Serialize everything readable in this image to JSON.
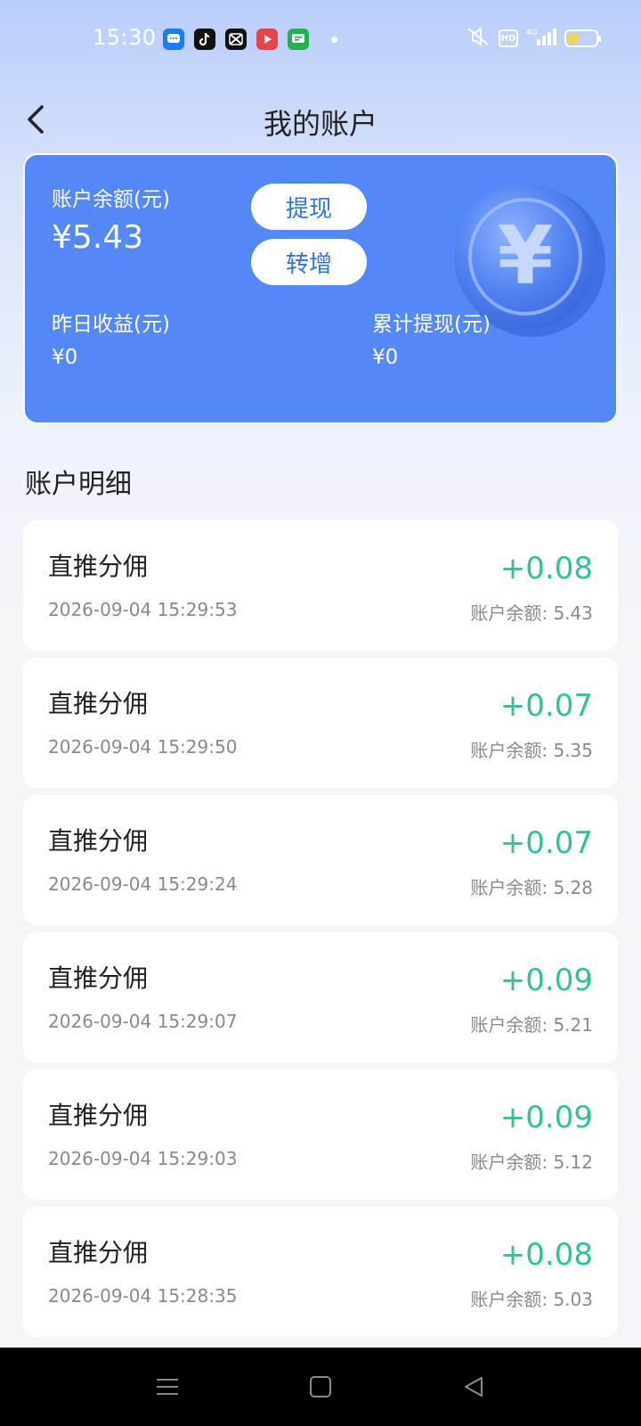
{
  "status_bar": {
    "time": "15:30",
    "network": "4G",
    "hd": "HD",
    "battery_level": 0.35,
    "notifications": [
      "message-icon",
      "tiktok-icon",
      "capcut-icon",
      "video-icon",
      "chat-icon"
    ]
  },
  "header": {
    "title": "我的账户"
  },
  "balance_card": {
    "balance_label": "账户余额(元)",
    "balance_value": "¥5.43",
    "withdraw_label": "提现",
    "transfer_label": "转增",
    "yesterday_label": "昨日收益(元)",
    "yesterday_value": "¥0",
    "total_withdraw_label": "累计提现(元)",
    "total_withdraw_value": "¥0",
    "coin_symbol": "¥"
  },
  "details": {
    "section_title": "账户明细",
    "items": [
      {
        "title": "直推分佣",
        "time": "2026-09-04 15:29:53",
        "amount": "+0.08",
        "balance": "账户余额: 5.43"
      },
      {
        "title": "直推分佣",
        "time": "2026-09-04 15:29:50",
        "amount": "+0.07",
        "balance": "账户余额: 5.35"
      },
      {
        "title": "直推分佣",
        "time": "2026-09-04 15:29:24",
        "amount": "+0.07",
        "balance": "账户余额: 5.28"
      },
      {
        "title": "直推分佣",
        "time": "2026-09-04 15:29:07",
        "amount": "+0.09",
        "balance": "账户余额: 5.21"
      },
      {
        "title": "直推分佣",
        "time": "2026-09-04 15:29:03",
        "amount": "+0.09",
        "balance": "账户余额: 5.12"
      },
      {
        "title": "直推分佣",
        "time": "2026-09-04 15:28:35",
        "amount": "+0.08",
        "balance": "账户余额: 5.03"
      }
    ]
  },
  "colors": {
    "card_blue": "#5488f8",
    "amount_green": "#2fc29a",
    "button_text_blue": "#2f73e8"
  }
}
